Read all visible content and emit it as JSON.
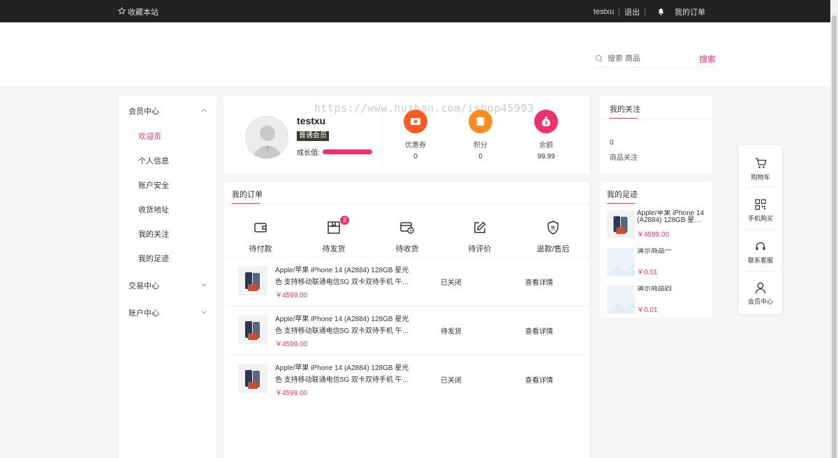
{
  "topbar": {
    "favorite_label": "收藏本站",
    "username": "testxu",
    "logout_label": "退出",
    "orders_label": "我的订单"
  },
  "search": {
    "placeholder": "搜索 商品",
    "button_label": "搜索"
  },
  "watermark": "https://www.huzhan.com/ishop45993",
  "sidebar": {
    "member_center": "会员中心",
    "items": [
      {
        "label": "欢迎页",
        "active": true
      },
      {
        "label": "个人信息"
      },
      {
        "label": "账户安全"
      },
      {
        "label": "收货地址"
      },
      {
        "label": "我的关注"
      },
      {
        "label": "我的足迹"
      }
    ],
    "trade_center": "交易中心",
    "account_center": "账户中心"
  },
  "profile": {
    "username": "testxu",
    "member_level": "普通会员",
    "growth_label": "成长值:",
    "growth_fraction": 1.0,
    "stats": [
      {
        "label": "优惠券",
        "value": "0",
        "color": "#ff5a1f"
      },
      {
        "label": "积分",
        "value": "0",
        "color": "#ff8a1f"
      },
      {
        "label": "余额",
        "value": "99.99",
        "color": "#f0306b"
      }
    ]
  },
  "orders": {
    "title": "我的订单",
    "statuses": [
      {
        "label": "待付款",
        "badge": ""
      },
      {
        "label": "待发货",
        "badge": "3"
      },
      {
        "label": "待收货",
        "badge": ""
      },
      {
        "label": "待评价",
        "badge": ""
      },
      {
        "label": "退款/售后",
        "badge": ""
      }
    ],
    "rows": [
      {
        "title": "Apple/苹果 iPhone 14 (A2884) 128GB 星光色 支持移动联通电信5G 双卡双待手机 午…",
        "price": "￥4599.00",
        "status": "已关闭",
        "action": "查看详情"
      },
      {
        "title": "Apple/苹果 iPhone 14 (A2884) 128GB 星光色 支持移动联通电信5G 双卡双待手机 午…",
        "price": "￥4599.00",
        "status": "待发货",
        "action": "查看详情"
      },
      {
        "title": "Apple/苹果 iPhone 14 (A2884) 128GB 星光色 支持移动联通电信5G 双卡双待手机 午…",
        "price": "￥4599.00",
        "status": "已关闭",
        "action": "查看详情"
      }
    ]
  },
  "follow": {
    "title": "我的关注",
    "count": "0",
    "count_label": "商品关注"
  },
  "footprint": {
    "title": "我的足迹",
    "items": [
      {
        "name": "Apple/苹果 iPhone 14 (A2884) 128GB 星…",
        "price": "￥4599.00"
      },
      {
        "name": "演示商品一",
        "price": "￥0.01"
      },
      {
        "name": "演示商品四",
        "price": "￥0.01"
      }
    ]
  },
  "floatbar": [
    {
      "label": "购物车",
      "icon": "cart-icon"
    },
    {
      "label": "手机购买",
      "icon": "qrcode-icon"
    },
    {
      "label": "联系客服",
      "icon": "headset-icon"
    },
    {
      "label": "会员中心",
      "icon": "user-icon"
    }
  ],
  "colors": {
    "accent": "#f0306b",
    "topbar": "#222222"
  }
}
